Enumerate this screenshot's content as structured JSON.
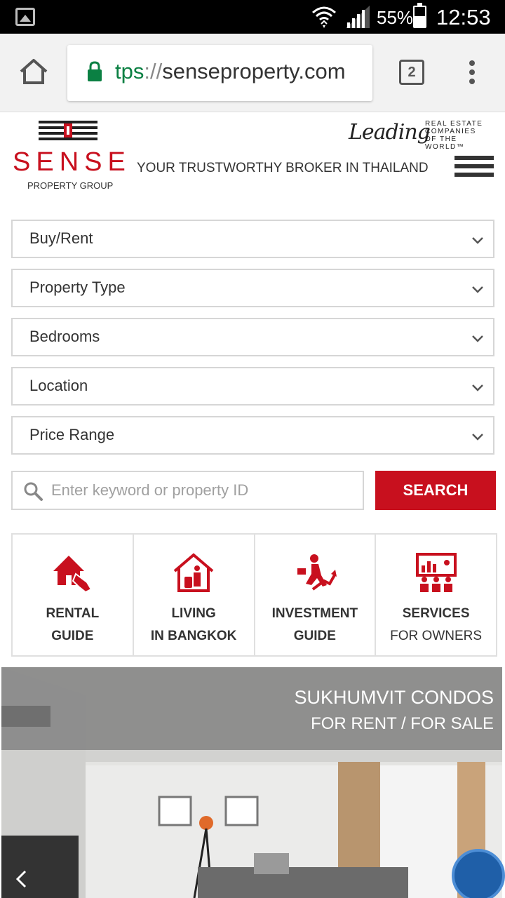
{
  "status_bar": {
    "battery_percent": "55%",
    "battery_level": 0.55,
    "time": "12:53"
  },
  "browser": {
    "url_scheme": "tps",
    "url_sep": "://",
    "url_host": "senseproperty.com",
    "tab_count": "2"
  },
  "header": {
    "logo_word": "SENSE",
    "logo_sub": "PROPERTY GROUP",
    "tagline": "YOUR TRUSTWORTHY BROKER IN THAILAND",
    "leading_script": "Leading",
    "leading_line1": "REAL ESTATE",
    "leading_line2": "COMPANIES",
    "leading_line3": "OF THE WORLD™"
  },
  "filters": [
    {
      "label": "Buy/Rent"
    },
    {
      "label": "Property Type"
    },
    {
      "label": "Bedrooms"
    },
    {
      "label": "Location"
    },
    {
      "label": "Price Range"
    }
  ],
  "search": {
    "placeholder": "Enter keyword or property ID",
    "button_label": "SEARCH"
  },
  "guides": [
    {
      "line1": "RENTAL",
      "line2": "GUIDE",
      "icon": "house-hand-icon"
    },
    {
      "line1": "LIVING",
      "line2": "IN BANGKOK",
      "icon": "house-luggage-icon"
    },
    {
      "line1": "INVESTMENT",
      "line2": "GUIDE",
      "icon": "businessman-growth-icon"
    },
    {
      "line1": "SERVICES",
      "line2": "FOR OWNERS",
      "icon": "presentation-icon"
    }
  ],
  "hero": {
    "title": "SUKHUMVIT CONDOS",
    "subtitle": "FOR RENT / FOR SALE"
  },
  "colors": {
    "brand_red": "#c8101e",
    "url_green": "#0b8043",
    "chat_blue": "#1f5fa8"
  }
}
